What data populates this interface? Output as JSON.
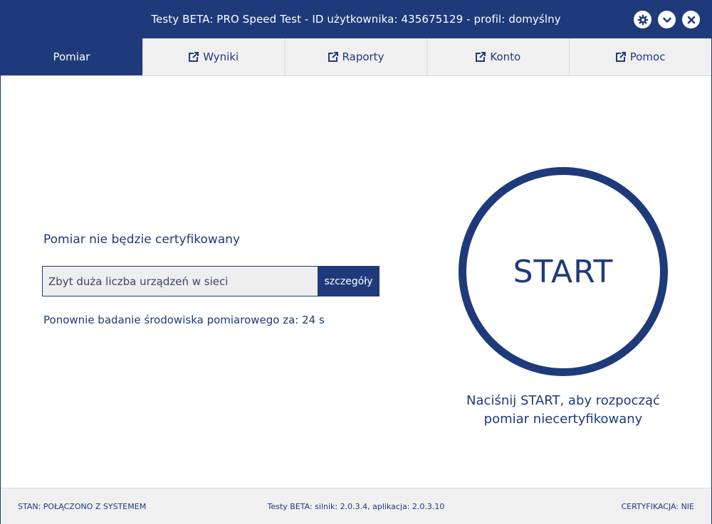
{
  "window": {
    "title": "Testy BETA: PRO Speed Test - ID użytkownika: 435675129 - profil: domyślny",
    "controls": [
      "gear-icon",
      "chevron-down-icon",
      "close-icon"
    ]
  },
  "tabs": [
    {
      "label": "Pomiar",
      "active": true,
      "icon": null
    },
    {
      "label": "Wyniki",
      "active": false,
      "icon": "external-link-icon"
    },
    {
      "label": "Raporty",
      "active": false,
      "icon": "external-link-icon"
    },
    {
      "label": "Konto",
      "active": false,
      "icon": "external-link-icon"
    },
    {
      "label": "Pomoc",
      "active": false,
      "icon": "external-link-icon"
    }
  ],
  "main": {
    "certification_heading": "Pomiar nie będzie certyfikowany",
    "warning_text": "Zbyt duża liczba urządzeń w sieci",
    "details_button": "szczegóły",
    "retest_text": "Ponownie badanie środowiska pomiarowego za: 24 s",
    "start_label": "START",
    "start_hint_line1": "Naciśnij START, aby rozpocząć",
    "start_hint_line2": "pomiar niecertyfikowany"
  },
  "status": {
    "state": "STAN: POŁĄCZONO Z SYSTEMEM",
    "version": "Testy BETA: silnik: 2.0.3.4, aplikacja: 2.0.3.10",
    "certification": "CERTYFIKACJA: NIE"
  },
  "colors": {
    "brand": "#1e3a7b",
    "tab_bg": "#f0f0f1",
    "box_bg": "#eeeeef"
  }
}
